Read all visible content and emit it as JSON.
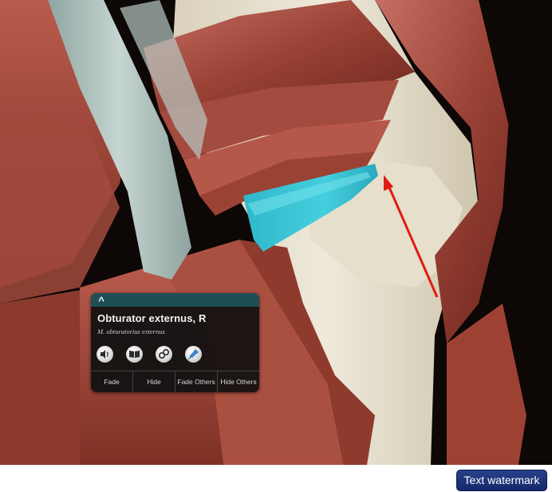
{
  "info_card": {
    "collapse_glyph": "^",
    "title": "Obturator externus, R",
    "latin_name": "M. obturatorius externus",
    "icons": [
      "speaker-icon",
      "book-icon",
      "link-icon",
      "pin-icon"
    ],
    "actions": {
      "fade": "Fade",
      "hide": "Hide",
      "fade_others": "Fade Others",
      "hide_others": "Hide Others"
    }
  },
  "watermark": {
    "label": "Text watermark"
  },
  "colors": {
    "highlight_muscle": "#38c3d3",
    "pointer_arrow": "#e11a12",
    "card_header": "#1e4e56",
    "watermark_bg": "#1d3478"
  }
}
